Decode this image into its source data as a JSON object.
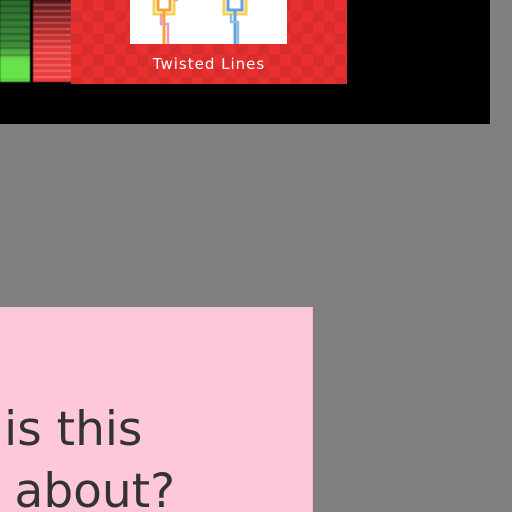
{
  "shelf": {
    "tiles": [
      {
        "name": "green-game-tile"
      },
      {
        "name": "red-game-tile"
      },
      {
        "name": "twisted-lines-tile",
        "title": "Twisted Lines"
      }
    ]
  },
  "note": {
    "line1": "at is this",
    "line2": "ny about?"
  },
  "colors": {
    "background": "#808080",
    "shelf": "#000000",
    "tile_red": "#e8302f",
    "note_pink": "#ffc8d8",
    "note_text": "#333333"
  }
}
